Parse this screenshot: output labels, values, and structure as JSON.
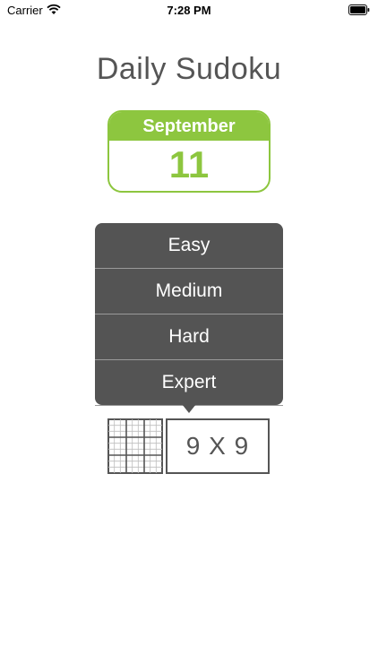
{
  "status_bar": {
    "carrier": "Carrier",
    "time": "7:28 PM"
  },
  "title": "Daily Sudoku",
  "calendar": {
    "month": "September",
    "day": "11",
    "accent": "#8dc63f"
  },
  "difficulty_menu": {
    "items": [
      {
        "label": "Easy"
      },
      {
        "label": "Medium"
      },
      {
        "label": "Hard"
      },
      {
        "label": "Expert"
      }
    ]
  },
  "grid_size": {
    "label": "9 X 9"
  }
}
